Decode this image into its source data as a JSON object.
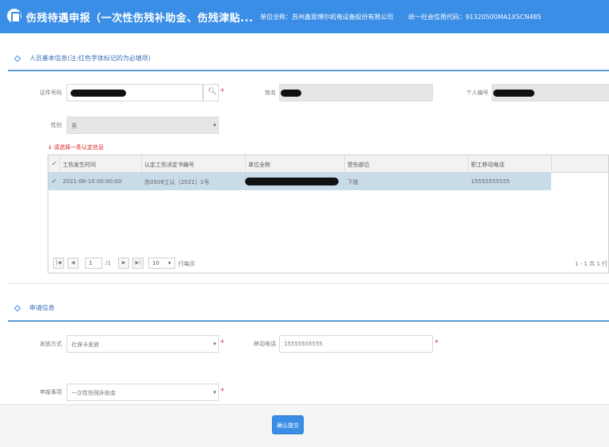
{
  "header": {
    "title": "伤残待遇申报（一次性伤残补助金、伤残津贴...",
    "unit_label": "单位全称：",
    "unit_name": "苏州鑫恩博尔机电设备股份有限公司",
    "credit_label": "统一社会信用代码：",
    "credit_code": "91320500MA1X5CN485"
  },
  "section1": {
    "title": "人员基本信息(注:红色字体标记的为必填项)"
  },
  "form1": {
    "id_label": "证件号码",
    "name_label": "姓名",
    "person_no_label": "个人编号",
    "gender_label": "性别",
    "gender_value": "男"
  },
  "hint": "请选择一条认定信息",
  "grid": {
    "columns": [
      "工伤发生时间",
      "认定工伤决定书编号",
      "单位全称",
      "受伤部位",
      "职工移动电话"
    ],
    "rows": [
      {
        "time": "2021-06-10 00:00:00",
        "decision_no": "苏0509工认〔2021〕1号",
        "body_part": "下肢",
        "phone": "15555555555"
      }
    ],
    "pager": {
      "page": "1",
      "total_pages": "/1",
      "page_size": "10",
      "per_page_label": "行每页",
      "summary": "1 - 1 共 1 行"
    }
  },
  "section2": {
    "title": "申请信息"
  },
  "form2": {
    "payment_label": "发放方式",
    "payment_value": "社保卡发放",
    "phone_label": "移动电话",
    "phone_value": "15555555555",
    "item_label": "申报事项",
    "item_value": "一次性伤残补助金"
  },
  "footer": {
    "submit_label": "确认提交"
  },
  "colors": {
    "brand": "#3a8ee6",
    "required": "#e02020",
    "selected_row": "#c8dbe8"
  },
  "icons": {
    "search": "search-icon",
    "dropdown": "chevron-down-icon",
    "check": "check-icon"
  }
}
